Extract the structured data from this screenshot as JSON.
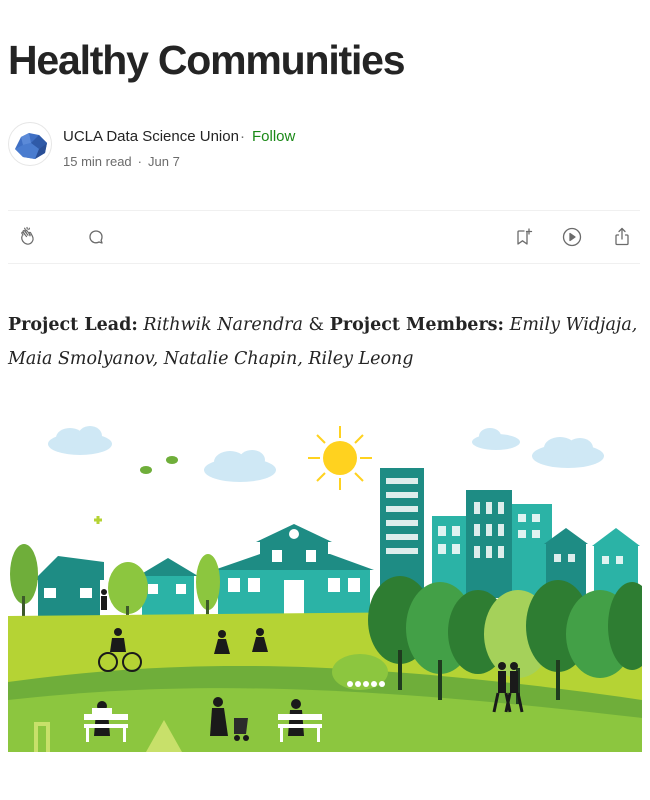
{
  "article": {
    "title": "Healthy Communities"
  },
  "author": {
    "name": "UCLA Data Science Union",
    "separator": "·",
    "follow_label": "Follow",
    "read_time": "15 min read",
    "meta_separator": "·",
    "date": "Jun 7",
    "avatar_icon": "bear-logo-icon"
  },
  "actions": {
    "clap_icon": "clap-icon",
    "comment_icon": "comment-icon",
    "save_icon": "bookmark-add-icon",
    "listen_icon": "play-icon",
    "share_icon": "share-icon"
  },
  "byline": {
    "lead_label": "Project Lead:",
    "lead_name": "Rithwik Narendra",
    "amp": "&",
    "members_label": "Project Members:",
    "members_names": "Emily Widjaja, Maia Smolyanov, Natalie Chapin, Riley Leong"
  },
  "hero": {
    "alt": "Illustration of a green city park with buildings, trees and people",
    "colors": {
      "teal": "#1e8c84",
      "teal_light": "#2bb3a6",
      "grass": "#b5d334",
      "grass_dark": "#6fae3a",
      "tree_dark": "#2e7d32",
      "sky_cloud": "#cfe8f5",
      "sun": "#ffd21f"
    }
  }
}
